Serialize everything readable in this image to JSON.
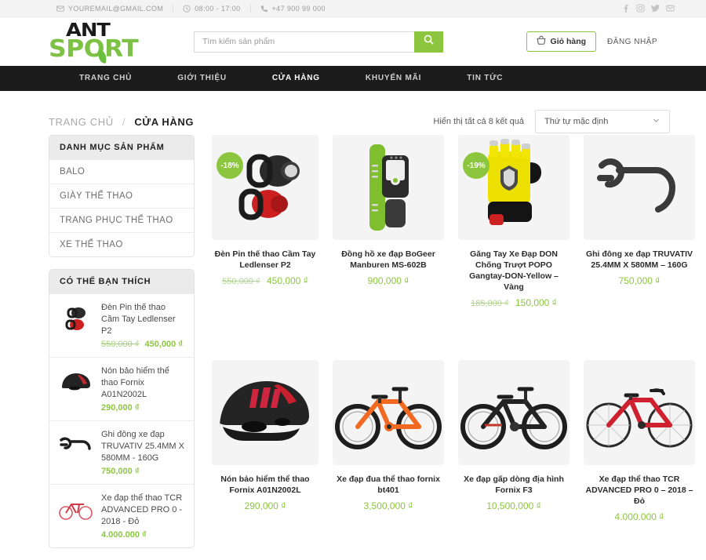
{
  "topbar": {
    "email": "YOUREMAIL@GMAIL.COM",
    "hours": "08:00 - 17:00",
    "phone": "+47 900 99 000",
    "social": [
      "facebook-icon",
      "instagram-icon",
      "twitter-icon",
      "email-icon"
    ]
  },
  "header": {
    "logo_top": "ANT",
    "logo_bottom": "SPORT",
    "search_placeholder": "Tìm kiếm sản phẩm",
    "search_value": "",
    "cart_label": "Giỏ hàng",
    "login_label": "ĐĂNG NHẬP"
  },
  "nav": {
    "items": [
      {
        "label": "TRANG CHỦ",
        "active": false
      },
      {
        "label": "GIỚI THIỆU",
        "active": false
      },
      {
        "label": "CỬA HÀNG",
        "active": true
      },
      {
        "label": "KHUYẾN MÃI",
        "active": false
      },
      {
        "label": "TIN TỨC",
        "active": false
      }
    ]
  },
  "breadcrumb": {
    "home": "TRANG CHỦ",
    "separator": "/",
    "current": "CỬA HÀNG"
  },
  "toolbar": {
    "result_count": "Hiển thị tất cả 8 kết quả",
    "sort_value": "Thứ tự mặc định"
  },
  "sidebar": {
    "categories": {
      "title": "DANH MỤC SẢN PHẨM",
      "items": [
        {
          "label": "BALO"
        },
        {
          "label": "GIÀY THỂ THAO"
        },
        {
          "label": "TRANG PHỤC THỂ THAO"
        },
        {
          "label": "XE THỂ THAO"
        }
      ]
    },
    "liked": {
      "title": "CÓ THỂ BẠN THÍCH",
      "items": [
        {
          "title": "Đèn Pin thế thao Cầm Tay Ledlenser P2",
          "old_price": "550,000 ₫",
          "price": "450,000 ₫",
          "thumb": "bike-light-icon"
        },
        {
          "title": "Nón bảo hiểm thể thao Fornix A01N2002L",
          "old_price": "",
          "price": "290,000 ₫",
          "thumb": "helmet-icon"
        },
        {
          "title": "Ghi đông xe đạp TRUVATIV 25.4MM X 580MM - 160G",
          "old_price": "",
          "price": "750,000 ₫",
          "thumb": "handlebar-icon"
        },
        {
          "title": "Xe đạp thể thao TCR ADVANCED PRO 0 - 2018 - Đỏ",
          "old_price": "",
          "price": "4.000.000 ₫",
          "thumb": "road-bike-icon"
        }
      ]
    }
  },
  "products": [
    {
      "title": "Đèn Pin thế thao Cầm Tay Ledlenser P2",
      "old_price": "550,000 ₫",
      "price": "450,000 ₫",
      "badge": "-18%",
      "image": "bike-lights-image"
    },
    {
      "title": "Đồng hồ xe đạp BoGeer Manburen MS-602B",
      "old_price": "",
      "price": "900,000 ₫",
      "badge": "",
      "image": "cycling-watch-image"
    },
    {
      "title": "Găng Tay Xe Đạp DON Chống Trượt POPO Gangtay-DON-Yellow – Vàng",
      "old_price": "185,000 ₫",
      "price": "150,000 ₫",
      "badge": "-19%",
      "image": "cycling-glove-image"
    },
    {
      "title": "Ghi đông xe đạp TRUVATIV 25.4MM X 580MM – 160G",
      "old_price": "",
      "price": "750,000 ₫",
      "badge": "",
      "image": "handlebar-image"
    },
    {
      "title": "Nón bảo hiểm thể thao Fornix A01N2002L",
      "old_price": "",
      "price": "290,000 ₫",
      "badge": "",
      "image": "helmet-image"
    },
    {
      "title": "Xe đạp đua thể thao fornix bt401",
      "old_price": "",
      "price": "3,500,000 ₫",
      "badge": "",
      "image": "orange-mtb-image"
    },
    {
      "title": "Xe đạp gấp dòng địa hình Fornix F3",
      "old_price": "",
      "price": "10,500,000 ₫",
      "badge": "",
      "image": "black-mtb-image"
    },
    {
      "title": "Xe đạp thể thao TCR ADVANCED PRO 0 – 2018 – Đỏ",
      "old_price": "",
      "price": "4.000.000 ₫",
      "badge": "",
      "image": "red-road-bike-image"
    }
  ],
  "colors": {
    "accent": "#8cc63f",
    "nav_bg": "#1c1c1c",
    "card_bg": "#f4f4f4"
  }
}
